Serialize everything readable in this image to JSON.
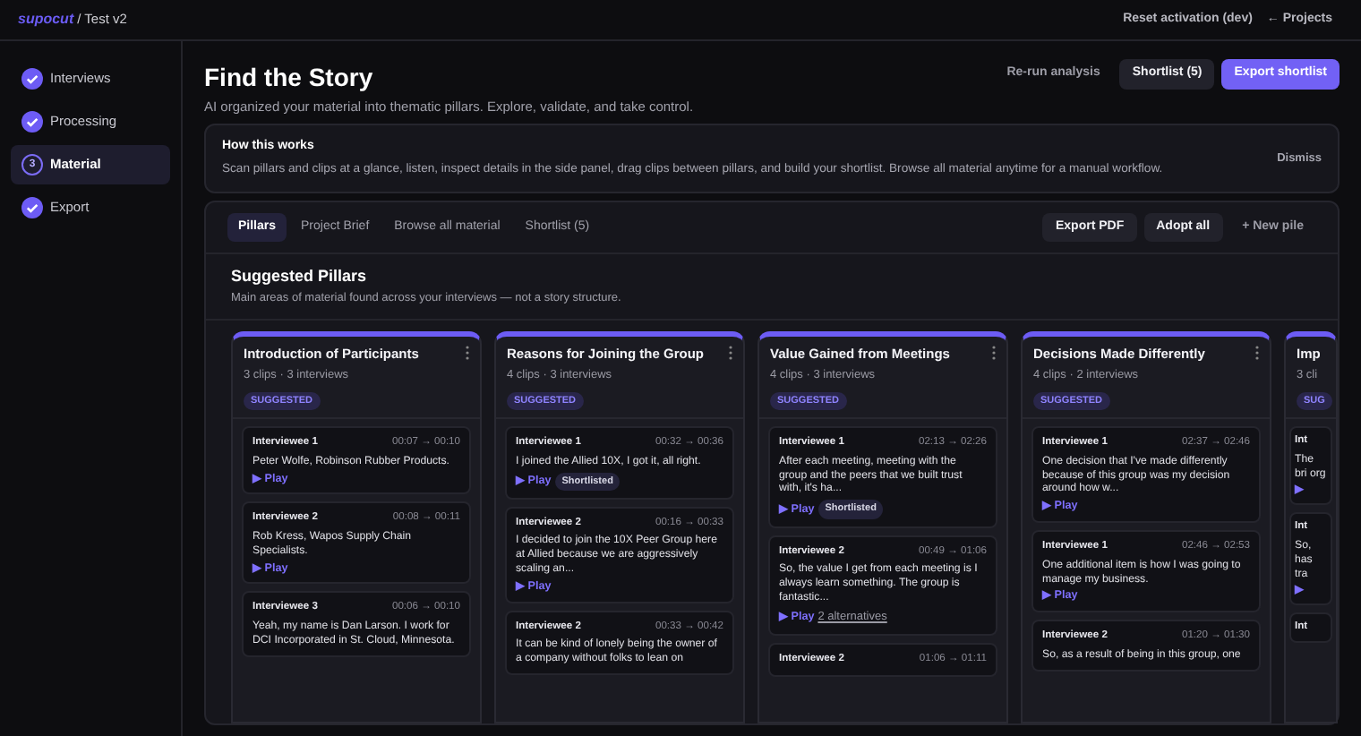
{
  "topbar": {
    "logo": "supocut",
    "project": "/ Test v2",
    "actions": [
      "Reset activation (dev)",
      "← Projects"
    ]
  },
  "steps": [
    {
      "label": "Interviews",
      "kind": "done",
      "selected": false
    },
    {
      "label": "Processing",
      "kind": "done",
      "selected": false
    },
    {
      "label": "Material",
      "kind": "current",
      "number": "3",
      "selected": true
    },
    {
      "label": "Export",
      "kind": "done",
      "selected": false
    }
  ],
  "header": {
    "title": "Find the Story",
    "subtitle": "AI organized your material into thematic pillars. Explore, validate, and take control.",
    "buttons": [
      {
        "label": "Re-run analysis",
        "kind": "link"
      },
      {
        "label": "Shortlist (5)",
        "kind": "secondary"
      },
      {
        "label": "Export shortlist",
        "kind": "primary"
      }
    ]
  },
  "notice": {
    "title": "How this works",
    "text": "Scan pillars and clips at a glance, listen, inspect details in the side panel, drag clips between pillars, and build your shortlist. Browse all material anytime for a manual workflow.",
    "dismiss": "Dismiss"
  },
  "tabs": [
    {
      "label": "Pillars",
      "selected": true
    },
    {
      "label": "Project Brief",
      "selected": false
    },
    {
      "label": "Browse all material",
      "selected": false
    },
    {
      "label": "Shortlist (5)",
      "selected": false
    }
  ],
  "toolbar": [
    {
      "label": "Export PDF",
      "kind": "secondary"
    },
    {
      "label": "Adopt all",
      "kind": "secondary"
    },
    {
      "label": "+ New pile",
      "kind": "link"
    }
  ],
  "section": {
    "title": "Suggested Pillars",
    "subtitle": "Main areas of material found across your interviews — not a story structure."
  },
  "pillars": [
    {
      "title": "Introduction of Participants",
      "meta": "3 clips · 3 interviews",
      "badge": "SUGGESTED",
      "clips": [
        {
          "speaker": "Interviewee 1",
          "time": "00:07 → 00:10",
          "text": "Peter Wolfe, Robinson Rubber Products.",
          "play": "▶ Play"
        },
        {
          "speaker": "Interviewee 2",
          "time": "00:08 → 00:11",
          "text": "Rob Kress, Wapos Supply Chain Specialists.",
          "play": "▶ Play"
        },
        {
          "speaker": "Interviewee 3",
          "time": "00:06 → 00:10",
          "text": "Yeah, my name is Dan Larson. I work for DCI Incorporated in St. Cloud, Minnesota."
        }
      ]
    },
    {
      "title": "Reasons for Joining the Group",
      "meta": "4 clips · 3 interviews",
      "badge": "SUGGESTED",
      "clips": [
        {
          "speaker": "Interviewee 1",
          "time": "00:32 → 00:36",
          "text": "I joined the Allied 10X, I got it, all right.",
          "play": "▶ Play",
          "tag": "Shortlisted"
        },
        {
          "speaker": "Interviewee 2",
          "time": "00:16 → 00:33",
          "text": "I decided to join the 10X Peer Group here at Allied because we are aggressively scaling an...",
          "play": "▶ Play"
        },
        {
          "speaker": "Interviewee 2",
          "time": "00:33 → 00:42",
          "text": "It can be kind of lonely being the owner of a company without folks to lean on"
        }
      ]
    },
    {
      "title": "Value Gained from Meetings",
      "meta": "4 clips · 3 interviews",
      "badge": "SUGGESTED",
      "clips": [
        {
          "speaker": "Interviewee 1",
          "time": "02:13 → 02:26",
          "text": "After each meeting, meeting with the group and the peers that we built trust with, it's ha...",
          "play": "▶ Play",
          "tag": "Shortlisted"
        },
        {
          "speaker": "Interviewee 2",
          "time": "00:49 → 01:06",
          "text": "So, the value I get from each meeting is I always learn something. The group is fantastic...",
          "play": "▶ Play",
          "link": "2 alternatives"
        },
        {
          "speaker": "Interviewee 2",
          "time": "01:06 → 01:11"
        }
      ]
    },
    {
      "title": "Decisions Made Differently",
      "meta": "4 clips · 2 interviews",
      "badge": "SUGGESTED",
      "clips": [
        {
          "speaker": "Interviewee 1",
          "time": "02:37 → 02:46",
          "text": "One decision that I've made differently because of this group was my decision around how w...",
          "play": "▶ Play"
        },
        {
          "speaker": "Interviewee 1",
          "time": "02:46 → 02:53",
          "text": "One additional item is how I was going to manage my business.",
          "play": "▶ Play"
        },
        {
          "speaker": "Interviewee 2",
          "time": "01:20 → 01:30",
          "text": "So, as a result of being in this group, one"
        }
      ]
    },
    {
      "title": "Imp",
      "meta": "3 cli",
      "badge": "SUG",
      "clips": [
        {
          "speaker": "Int",
          "text": "The bri org",
          "play": "▶"
        },
        {
          "speaker": "Int",
          "text": "So, has tra",
          "play": "▶"
        },
        {
          "speaker": "Int"
        }
      ]
    }
  ]
}
